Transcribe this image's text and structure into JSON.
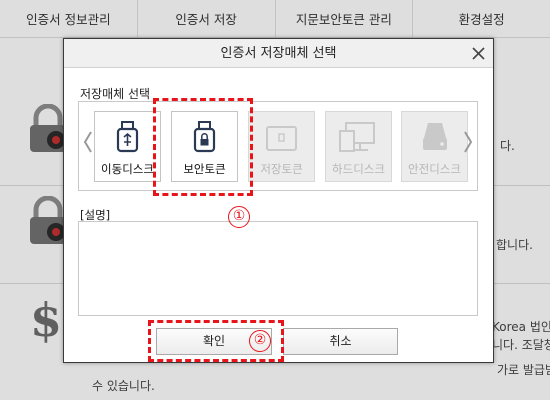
{
  "tabs": [
    {
      "label": "인증서 정보관리"
    },
    {
      "label": "인증서 저장"
    },
    {
      "label": "지문보안토큰 관리"
    },
    {
      "label": "환경설정"
    }
  ],
  "background": {
    "row1_text": "다.",
    "row2_text": "합니다.",
    "row3_line1": "Korea 법인",
    "row3_line2": "니다. 조달청",
    "row3_line3": "가로 발급받",
    "row3_line4": "수 있습니다."
  },
  "dialog": {
    "title": "인증서 저장매체 선택",
    "media_group_label": "저장매체 선택",
    "media_items": [
      {
        "label": "이동디스크",
        "icon": "usb-drive-icon",
        "enabled": true
      },
      {
        "label": "보안토큰",
        "icon": "security-token-icon",
        "enabled": true
      },
      {
        "label": "저장토큰",
        "icon": "storage-token-icon",
        "enabled": false
      },
      {
        "label": "하드디스크",
        "icon": "monitor-icon",
        "enabled": false
      },
      {
        "label": "안전디스크",
        "icon": "safe-disk-icon",
        "enabled": false
      }
    ],
    "description_label": "[설명]",
    "description_text": "",
    "ok_label": "확인",
    "cancel_label": "취소"
  },
  "annotations": {
    "badge1": "①",
    "badge2": "②",
    "color": "#e8141a"
  }
}
